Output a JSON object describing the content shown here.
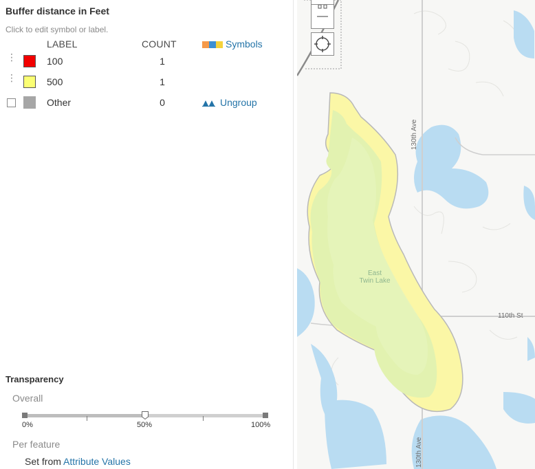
{
  "legend": {
    "title": "Buffer distance in Feet",
    "hint": "Click to edit symbol or label.",
    "col_label": "LABEL",
    "col_count": "COUNT",
    "symbols_link": "Symbols",
    "ungroup_link": "Ungroup",
    "rows": [
      {
        "label": "100",
        "count": "1",
        "color": "#f20000"
      },
      {
        "label": "500",
        "count": "1",
        "color": "#fbff74"
      },
      {
        "label": "Other",
        "count": "0",
        "color": "#a6a6a6"
      }
    ]
  },
  "transparency": {
    "heading": "Transparency",
    "overall_label": "Overall",
    "value_percent": 50,
    "ticks": [
      "0%",
      "50%",
      "100%"
    ],
    "per_feature_label": "Per feature",
    "set_from_prefix": "Set from",
    "set_from_link": "Attribute Values"
  },
  "map": {
    "zoom_out_glyph": "—",
    "lake_label_line1": "East",
    "lake_label_line2": "Twin Lake",
    "road_130th": "130th Ave",
    "road_130th_b": "130th Ave",
    "road_110th": "110th St",
    "colors": {
      "water": "#b9dcf2",
      "inner": "#e2f2b0",
      "outer": "#fbf7a6",
      "road": "#c9c9c9"
    }
  }
}
